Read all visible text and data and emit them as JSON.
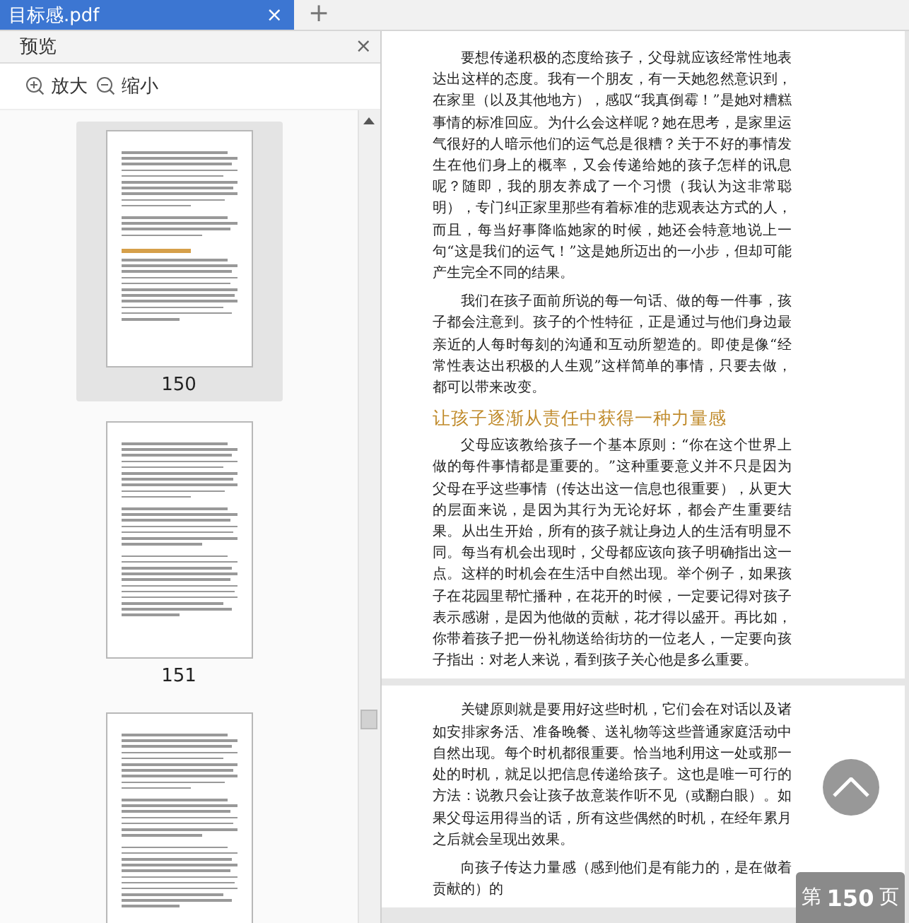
{
  "tab": {
    "title": "目标感.pdf",
    "close": "×",
    "new_tab": "+"
  },
  "preview_panel": {
    "title": "预览",
    "close": "×",
    "zoom_in": "放大",
    "zoom_out": "缩小",
    "thumbnails": [
      {
        "page": "150",
        "selected": true,
        "has_heading": true
      },
      {
        "page": "151",
        "selected": false,
        "has_heading": false
      },
      {
        "selected": false,
        "has_heading": false
      }
    ]
  },
  "document": {
    "pages": [
      {
        "blocks": [
          {
            "kind": "paragraph",
            "text": "要想传递积极的态度给孩子，父母就应该经常性地表达出这样的态度。我有一个朋友，有一天她忽然意识到，在家里（以及其他地方），感叹“我真倒霉！”是她对糟糕事情的标准回应。为什么会这样呢？她在思考，是家里运气很好的人暗示他们的运气总是很糟？关于不好的事情发生在他们身上的概率，又会传递给她的孩子怎样的讯息呢？随即，我的朋友养成了一个习惯（我认为这非常聪明），专门纠正家里那些有着标准的悲观表达方式的人，而且，每当好事降临她家的时候，她还会特意地说上一句“这是我们的运气！”这是她所迈出的一小步，但却可能产生完全不同的结果。"
          },
          {
            "kind": "paragraph",
            "text": "我们在孩子面前所说的每一句话、做的每一件事，孩子都会注意到。孩子的个性特征，正是通过与他们身边最亲近的人每时每刻的沟通和互动所塑造的。即使是像“经常性表达出积极的人生观”这样简单的事情，只要去做，都可以带来改变。"
          },
          {
            "kind": "heading",
            "text": "让孩子逐渐从责任中获得一种力量感"
          },
          {
            "kind": "paragraph",
            "text": "父母应该教给孩子一个基本原则：“你在这个世界上做的每件事情都是重要的。”这种重要意义并不只是因为父母在乎这些事情（传达出这一信息也很重要），从更大的层面来说，是因为其行为无论好坏，都会产生重要结果。从出生开始，所有的孩子就让身边人的生活有明显不同。每当有机会出现时，父母都应该向孩子明确指出这一点。这样的时机会在生活中自然出现。举个例子，如果孩子在花园里帮忙播种，在花开的时候，一定要记得对孩子表示感谢，是因为他做的贡献，花才得以盛开。再比如，你带着孩子把一份礼物送给街坊的一位老人，一定要向孩子指出：对老人来说，看到孩子关心他是多么重要。"
          }
        ]
      },
      {
        "blocks": [
          {
            "kind": "paragraph",
            "text": "关键原则就是要用好这些时机，它们会在对话以及诸如安排家务活、准备晚餐、送礼物等这些普通家庭活动中自然出现。每个时机都很重要。恰当地利用这一处或那一处的时机，就足以把信息传递给孩子。这也是唯一可行的方法：说教只会让孩子故意装作听不见（或翻白眼）。如果父母运用得当的话，所有这些偶然的时机，在经年累月之后就会呈现出效果。"
          },
          {
            "kind": "paragraph",
            "text": "向孩子传达力量感（感到他们是有能力的，是在做着贡献的）的"
          }
        ]
      }
    ]
  },
  "page_indicator": {
    "prefix": "第",
    "number": "150",
    "suffix": "页"
  }
}
